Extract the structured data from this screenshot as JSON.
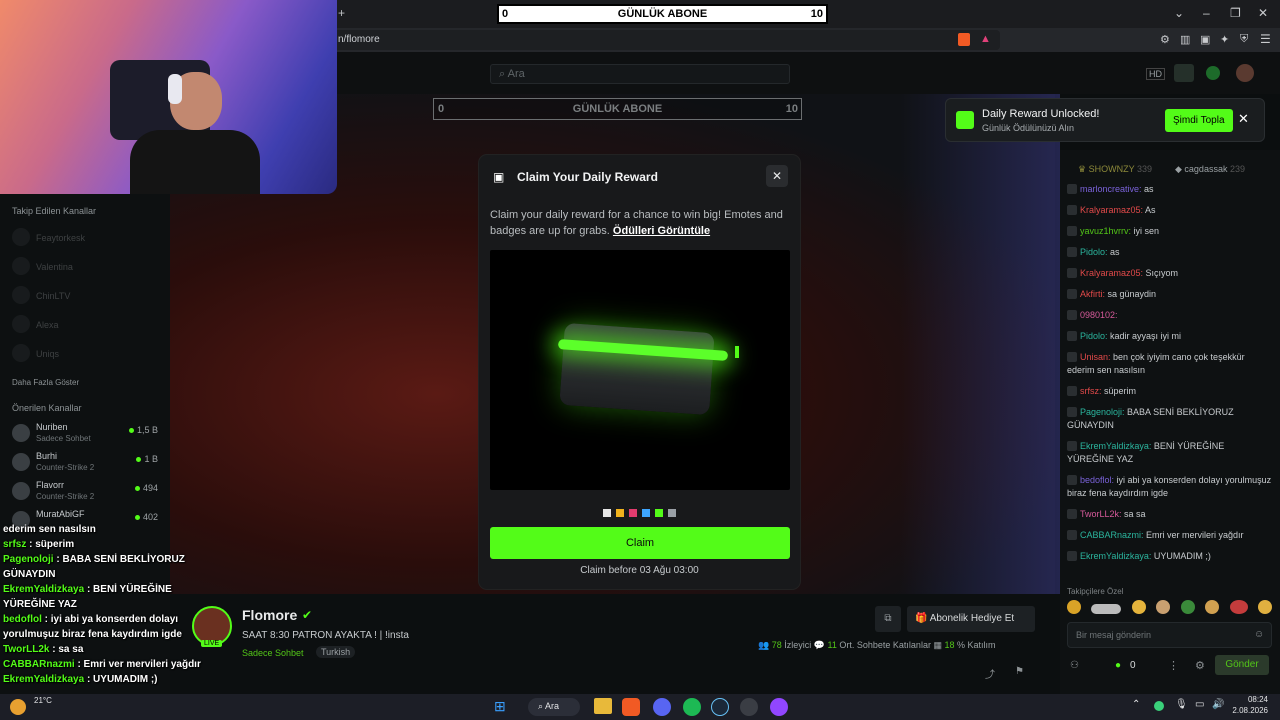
{
  "browser": {
    "url": "n/flomore",
    "new_tab": "+"
  },
  "site": {
    "search_placeholder": "Ara"
  },
  "overlay": {
    "abone_title": "GÜNLÜK ABONE",
    "abone_min": "0",
    "abone_max": "10"
  },
  "sidebar": {
    "followed_title": "Takip Edilen Kanallar",
    "followed": [
      "Feaytorkesk",
      "Valentina",
      "ChinLTV",
      "Alexa",
      "Uniqs"
    ],
    "show_more": "Daha Fazla Göster",
    "recommended_title": "Önerilen Kanallar",
    "recommended": [
      {
        "name": "Nuriben",
        "sub": "Sadece Sohbet",
        "count": "1,5 B"
      },
      {
        "name": "Burhi",
        "sub": "Counter-Strike 2",
        "count": "1 B"
      },
      {
        "name": "Flavorr",
        "sub": "Counter-Strike 2",
        "count": "494"
      },
      {
        "name": "MuratAbiGF",
        "sub": "",
        "count": "402"
      }
    ]
  },
  "toast": {
    "title": "Daily Reward Unlocked!",
    "subtitle": "Günlük Ödülünüzü Alın",
    "button": "Şimdi Topla"
  },
  "modal": {
    "title": "Claim Your Daily Reward",
    "desc": "Claim your daily reward for a chance to win big! Emotes and badges are up for grabs.",
    "link": "Ödülleri Görüntüle",
    "claim": "Claim",
    "deadline": "Claim before 03 Ağu 03:00",
    "swatches": [
      "#e6e6e6",
      "#f0b21d",
      "#e23b6e",
      "#3ea6ff",
      "#53fc18",
      "#9aa0a6"
    ]
  },
  "chat": {
    "header_users": [
      "SHOWNZY",
      "cagdassak"
    ],
    "header_counts": [
      "339",
      "239"
    ],
    "messages": [
      {
        "user": "marloncreative",
        "text": "as",
        "cls": "u-purple"
      },
      {
        "user": "Kralyaramaz05",
        "text": "As",
        "cls": "u-red"
      },
      {
        "user": "yavuz1hvrrv",
        "text": "iyi sen",
        "cls": "u-green"
      },
      {
        "user": "Pidolo",
        "text": "as",
        "cls": "u-teal"
      },
      {
        "user": "Kralyaramaz05",
        "text": "Sıçıyom",
        "cls": "u-red"
      },
      {
        "user": "Akfirti",
        "text": "sa günaydin",
        "cls": "u-red"
      },
      {
        "user": "0980102",
        "text": "",
        "cls": "u-pink"
      },
      {
        "user": "Pidolo",
        "text": "kadir ayyaşı iyi mi",
        "cls": "u-teal"
      },
      {
        "user": "Unisan",
        "text": "ben çok iyiyim cano çok teşekkür ederim sen nasılsın",
        "cls": "u-red"
      },
      {
        "user": "srfsz",
        "text": "süperim",
        "cls": "u-red"
      },
      {
        "user": "Pagenoloji",
        "text": "BABA SENİ BEKLİYORUZ GÜNAYDIN",
        "cls": "u-teal"
      },
      {
        "user": "EkremYaldizkaya",
        "text": "BENİ YÜREĞİNE YÜREĞİNE YAZ",
        "cls": "u-teal"
      },
      {
        "user": "bedoflol",
        "text": "iyi abi ya konserden dolayı yorulmuşuz biraz fena kaydırdım igde",
        "cls": "u-purple"
      },
      {
        "user": "TworLL2k",
        "text": "sa sa",
        "cls": "u-pink"
      },
      {
        "user": "CABBARnazmi",
        "text": "Emri ver mervileri yağdır",
        "cls": "u-teal"
      },
      {
        "user": "EkremYaldizkaya",
        "text": "UYUMADIM ;)",
        "cls": "u-teal"
      }
    ],
    "followers_label": "Takipçilere Özel",
    "input_placeholder": "Bir mesaj gönderin",
    "send": "Gönder",
    "points": "0"
  },
  "stream": {
    "name": "Flomore",
    "title": "SAAT 8:30 PATRON AYAKTA ! | !insta",
    "category": "Sadece Sohbet",
    "tag": "Turkish",
    "viewers": "78",
    "viewers_label": "İzleyici",
    "chatters": "11",
    "chatters_label": "Ort. Sohbete Katılanlar",
    "pct": "18",
    "pct_label": "% Katılım",
    "gift": "Abonelik Hediye Et",
    "live": "LIVE"
  },
  "overlay_chat": [
    {
      "user": "",
      "text": "ederim sen nasılsın"
    },
    {
      "user": "srfsz",
      "text": " : süperim"
    },
    {
      "user": "Pagenoloji",
      "text": " : BABA SENİ BEKLİYORUZ GÜNAYDIN"
    },
    {
      "user": "EkremYaldizkaya",
      "text": " : BENİ YÜREĞİNE YÜREĞİNE YAZ"
    },
    {
      "user": "bedoflol",
      "text": " : iyi abi ya konserden dolayı yorulmuşuz biraz fena kaydırdım igde"
    },
    {
      "user": "TworLL2k",
      "text": " : sa sa"
    },
    {
      "user": "CABBARnazmi",
      "text": " : Emri ver mervileri yağdır"
    },
    {
      "user": "EkremYaldizkaya",
      "text": " : UYUMADIM ;)"
    }
  ],
  "taskbar": {
    "search": "Ara",
    "time": "08:24",
    "date": "2.08.2026",
    "temp": "21°C"
  }
}
